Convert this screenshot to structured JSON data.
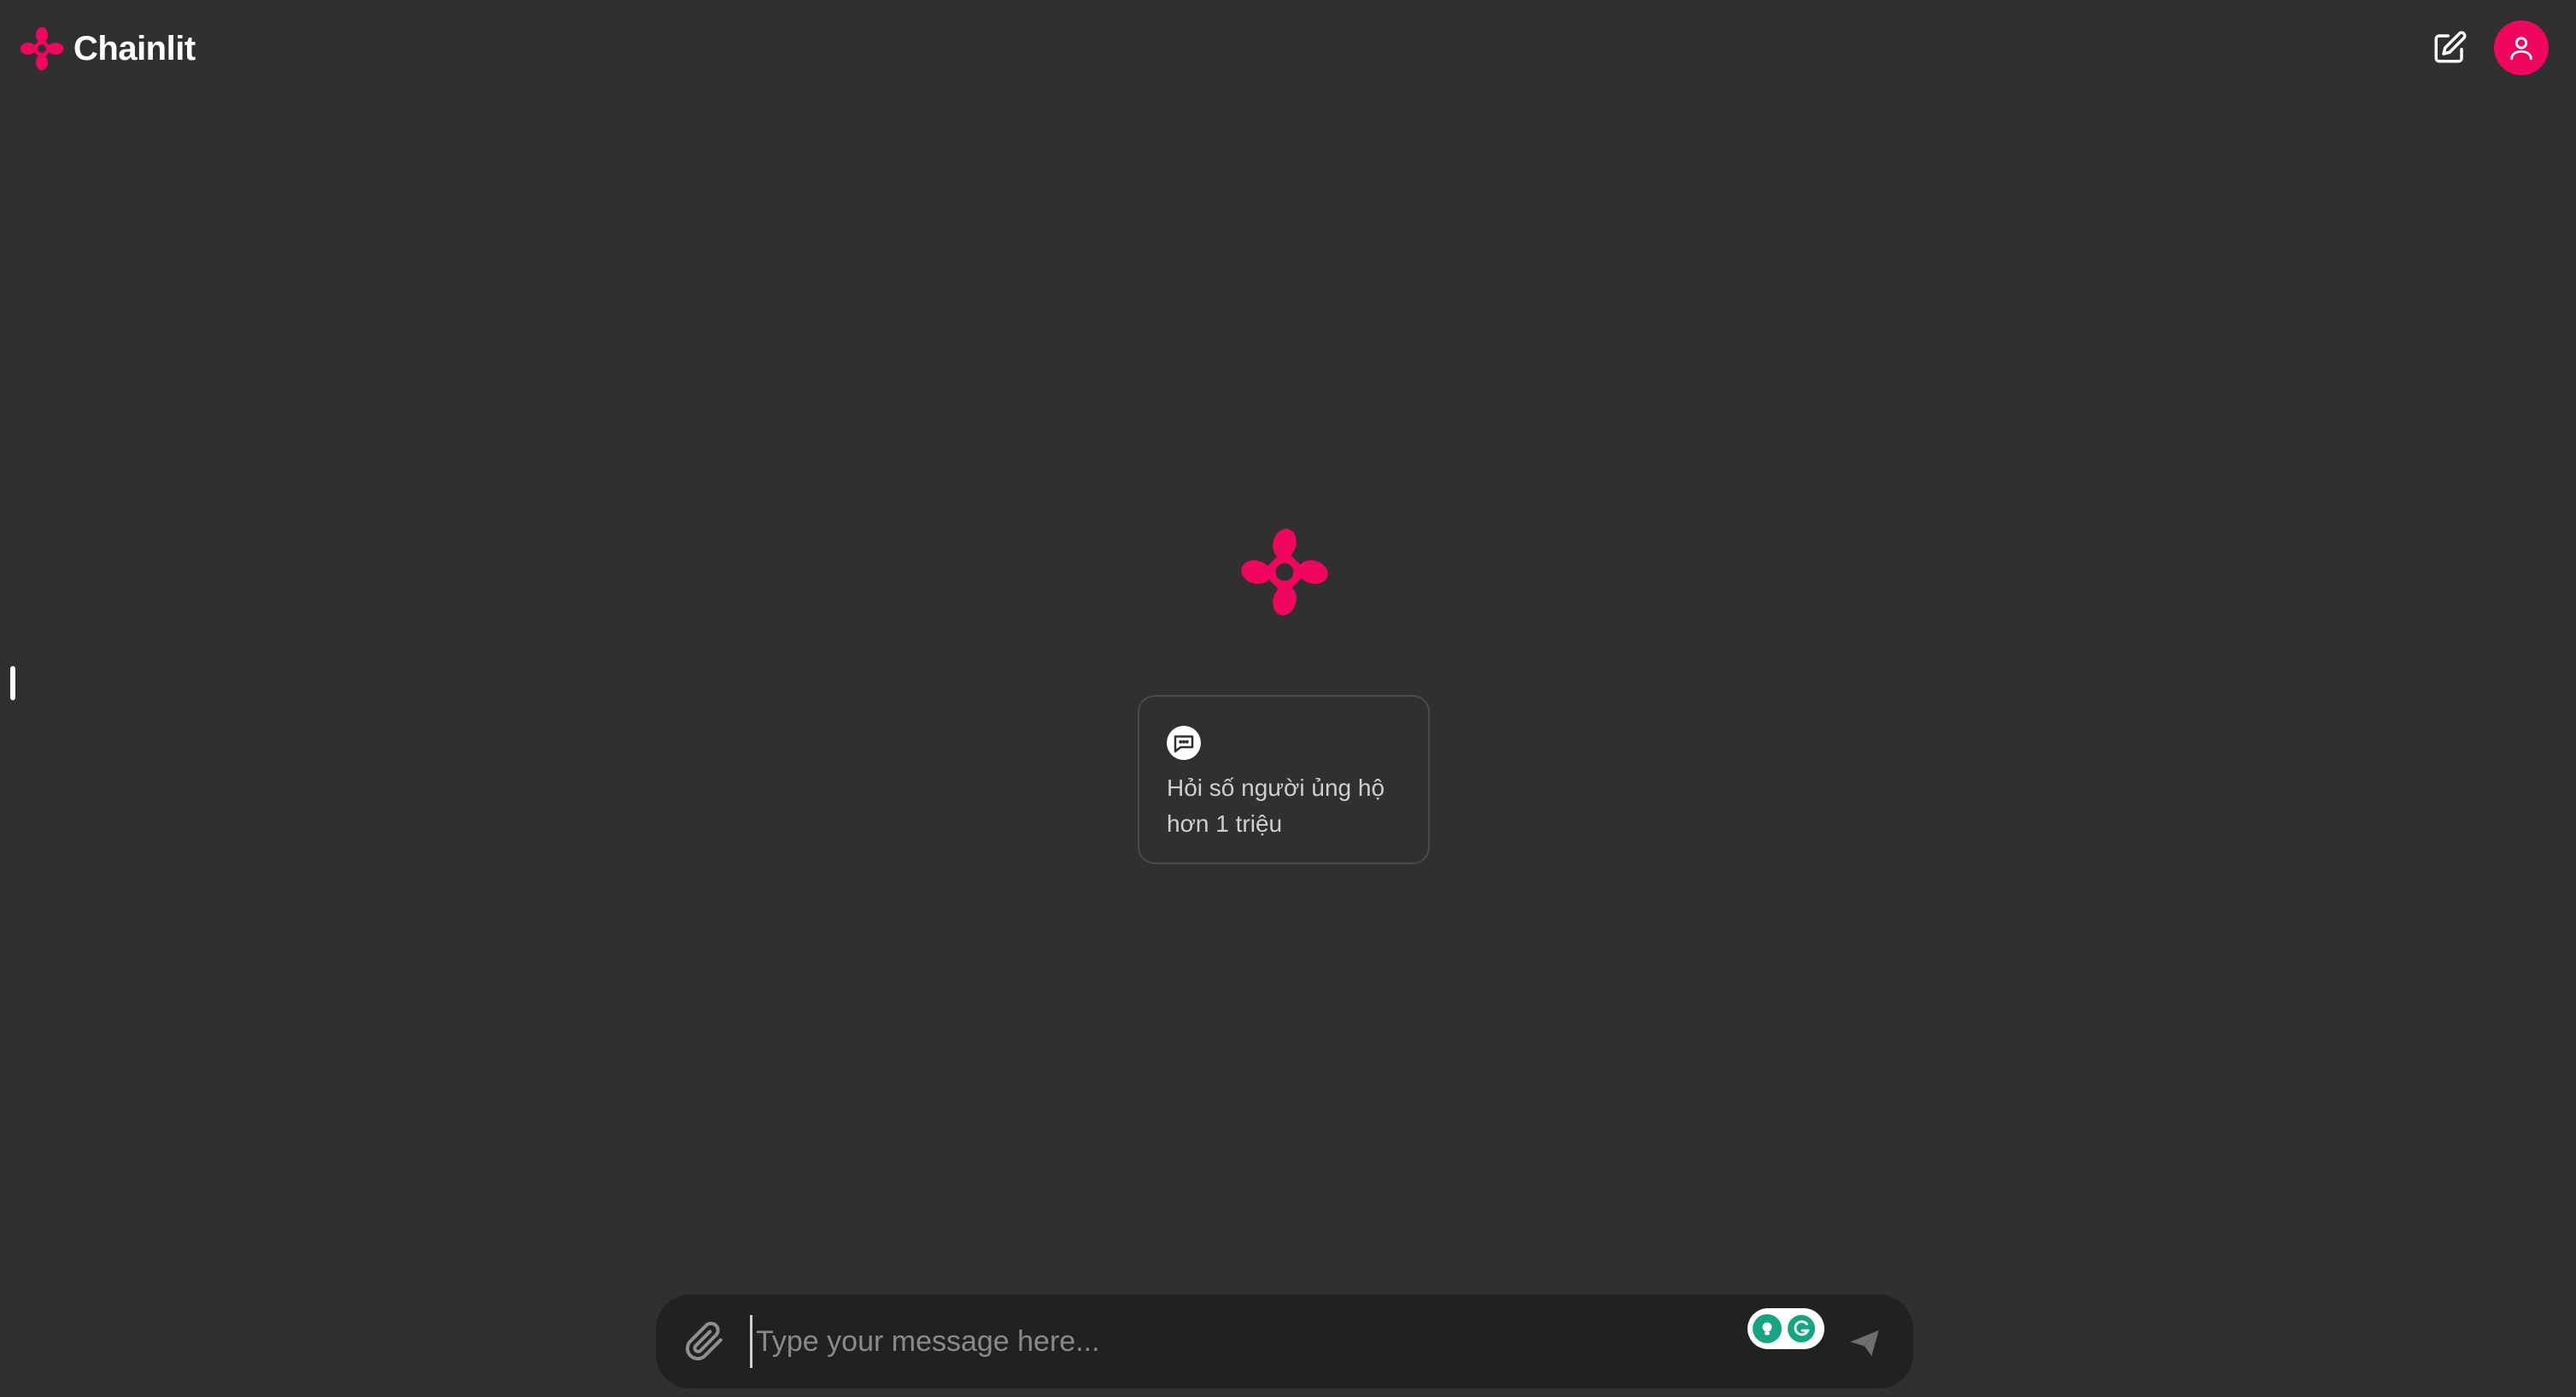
{
  "app": {
    "name": "Chainlit",
    "accent_color": "#f0055f",
    "background_color": "#303030"
  },
  "header": {
    "logo_icon": "chainlit-logo-icon",
    "new_chat_icon": "edit-square-icon",
    "user_icon": "user-icon"
  },
  "starters": [
    {
      "icon": "chat-bubble-icon",
      "label": "Hỏi số người ủng hộ hơn 1 triệu"
    }
  ],
  "composer": {
    "placeholder": "Type your message here...",
    "value": "",
    "attach_icon": "paperclip-icon",
    "send_icon": "send-icon",
    "extension_icon": "grammarly-icon"
  }
}
